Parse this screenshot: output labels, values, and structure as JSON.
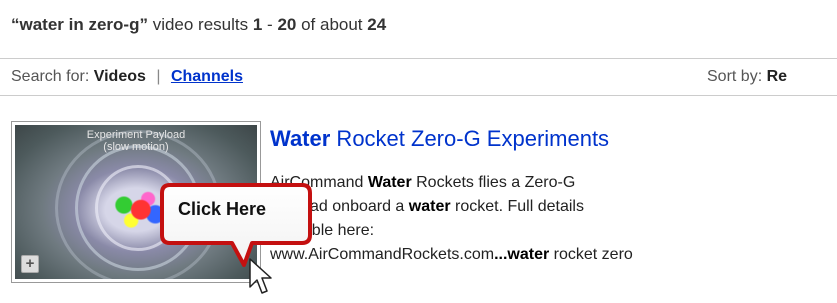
{
  "header": {
    "query": "“water in zero-g”",
    "results_text": " video results ",
    "range_start": "1",
    "range_sep": " - ",
    "range_end": "20",
    "of_about": " of about ",
    "total": "24"
  },
  "search_bar": {
    "search_for_label": "Search for:",
    "videos_label": "Videos",
    "separator": "|",
    "channels_label": "Channels",
    "sort_by_label": "Sort by:",
    "sort_value": "Re"
  },
  "result": {
    "thumbnail_caption_line1": "Experiment Payload",
    "thumbnail_caption_line2": "(slow motion)",
    "plus_label": "+",
    "title_keyword": "Water",
    "title_rest": " Rocket Zero-G Experiments",
    "desc_line1_a": "AirCommand ",
    "desc_line1_b": "Water",
    "desc_line1_c": " Rockets flies a Zero-G",
    "desc_line2_a": "Payload onboard a ",
    "desc_line2_b": "water",
    "desc_line2_c": " rocket. Full details",
    "desc_line3": "available here:",
    "desc_line4_a": "www.AirCommandRockets.com",
    "desc_line4_b": "...water",
    "desc_line4_c": " rocket zero"
  },
  "callout": {
    "label": "Click Here",
    "fill_color": "#ffffff",
    "border_color": "#cc1111"
  },
  "colors": {
    "link": "#0033cc",
    "text": "#333333",
    "divider": "#cccccc"
  }
}
